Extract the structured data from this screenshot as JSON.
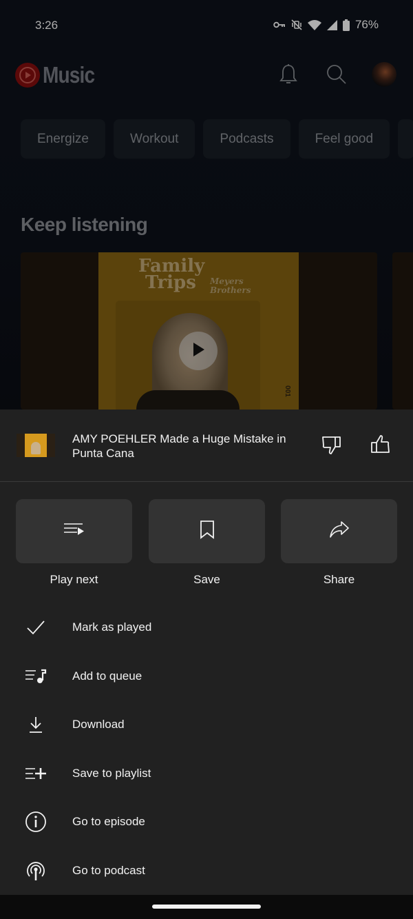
{
  "status_bar": {
    "time": "3:26",
    "battery_percent": "76%",
    "icons": [
      "vpn-key-icon",
      "vibrate-off-icon",
      "wifi-icon",
      "cell-signal-icon",
      "battery-icon"
    ]
  },
  "app_bar": {
    "logo_text": "Music",
    "icons": [
      "bell-icon",
      "search-icon",
      "avatar"
    ]
  },
  "chips": [
    {
      "label": "Energize"
    },
    {
      "label": "Workout"
    },
    {
      "label": "Podcasts"
    },
    {
      "label": "Feel good"
    }
  ],
  "section": {
    "title": "Keep listening"
  },
  "card": {
    "art_title_line1": "Family",
    "art_title_line2": "Trips",
    "art_sub_line1": "Meyers",
    "art_sub_line2": "Brothers",
    "episode_tag": "001"
  },
  "sheet": {
    "title": "AMY POEHLER Made a Huge Mistake in Punta Cana",
    "quick_actions": [
      {
        "label": "Play next",
        "icon": "play-next-icon"
      },
      {
        "label": "Save",
        "icon": "bookmark-icon"
      },
      {
        "label": "Share",
        "icon": "share-icon"
      }
    ],
    "menu": [
      {
        "label": "Mark as played",
        "icon": "check-icon"
      },
      {
        "label": "Add to queue",
        "icon": "queue-music-icon"
      },
      {
        "label": "Download",
        "icon": "download-icon"
      },
      {
        "label": "Save to playlist",
        "icon": "playlist-add-icon"
      },
      {
        "label": "Go to episode",
        "icon": "info-icon"
      },
      {
        "label": "Go to podcast",
        "icon": "podcast-icon"
      }
    ]
  },
  "colors": {
    "sheet_bg": "#212121",
    "tile_bg": "#333333",
    "brand_red": "#7a0d0d"
  }
}
